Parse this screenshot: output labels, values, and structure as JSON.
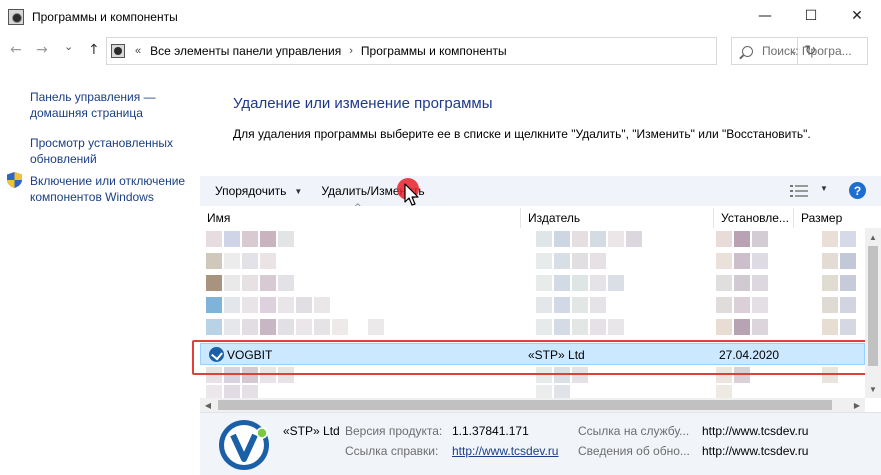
{
  "window": {
    "title": "Программы и компоненты",
    "minimize_glyph": "—",
    "maximize_glyph": "☐",
    "close_glyph": "✕"
  },
  "addressbar": {
    "back_glyph": "←",
    "forward_glyph": "→",
    "history_glyph": "⌄",
    "up_glyph": "↑",
    "overflow": "«",
    "breadcrumbs": [
      "Все элементы панели управления",
      "Программы и компоненты"
    ],
    "separator": "›",
    "dropdown_glyph": "⌄",
    "refresh_glyph": "↻"
  },
  "search": {
    "placeholder": "Поиск: Програ..."
  },
  "sidebar": {
    "links": [
      {
        "label": "Панель управления — домашняя страница"
      },
      {
        "label": "Просмотр установленных обновлений"
      },
      {
        "label": "Включение или отключение компонентов Windows"
      }
    ]
  },
  "main": {
    "heading": "Удаление или изменение программы",
    "instructions": "Для удаления программы выберите ее в списке и щелкните \"Удалить\", \"Изменить\" или \"Восстановить\"."
  },
  "toolbar": {
    "organize_label": "Упорядочить",
    "uninstall_label": "Удалить/Изменить",
    "dropdown_glyph": "▼",
    "help_label": "?"
  },
  "columns": {
    "name": "Имя",
    "publisher": "Издатель",
    "installed": "Установле...",
    "size": "Размер",
    "sort_glyph": "^"
  },
  "selected_program": {
    "name": "VOGBIT",
    "publisher": "«STP» Ltd",
    "installed": "27.04.2020",
    "size": ""
  },
  "scrollbars": {
    "left_glyph": "◀",
    "right_glyph": "▶",
    "up_glyph": "▲",
    "down_glyph": "▼"
  },
  "details": {
    "publisher": "«STP» Ltd",
    "version_label": "Версия продукта:",
    "version_value": "1.1.37841.171",
    "help_label": "Ссылка справки:",
    "help_value": "http://www.tcsdev.ru",
    "support_label": "Ссылка на службу...",
    "support_value": "http://www.tcsdev.ru",
    "update_label": "Сведения об обно...",
    "update_value": "http://www.tcsdev.ru"
  },
  "colors": {
    "link": "#1a3e87",
    "heading": "#1e3a8a",
    "selection": "#cce8ff",
    "highlight_frame": "#e0403a",
    "click_marker": "#e8212b"
  }
}
